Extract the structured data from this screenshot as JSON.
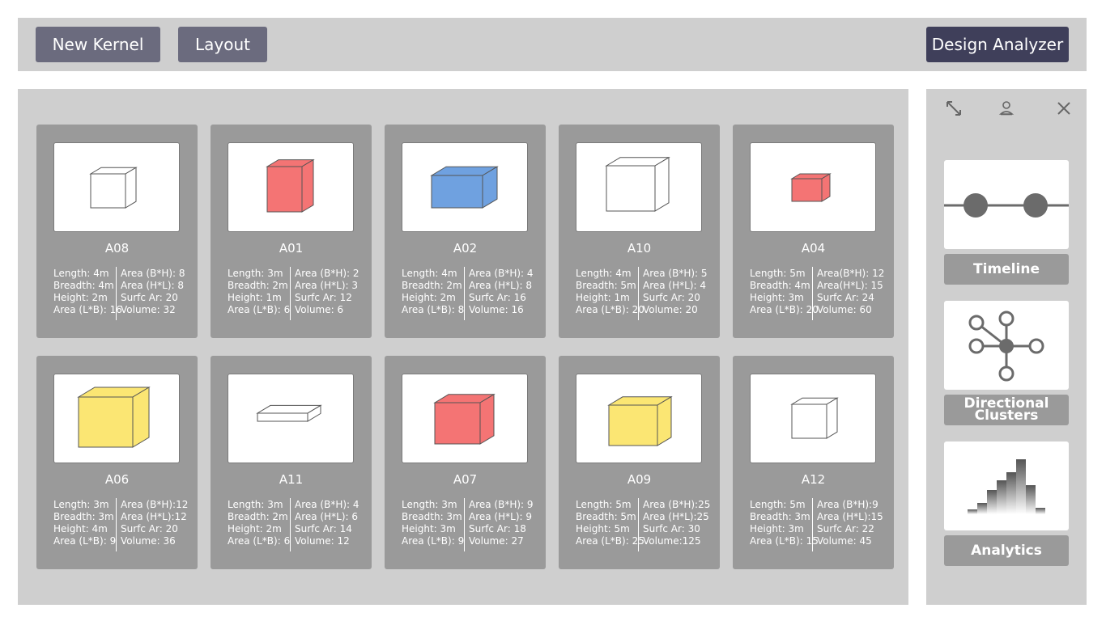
{
  "toolbar": {
    "new_kernel_label": "New Kernel",
    "layout_label": "Layout",
    "design_analyzer_label": "Design Analyzer"
  },
  "side": {
    "icons": [
      "resize-icon",
      "user-icon",
      "close-icon"
    ],
    "timeline_label": "Timeline",
    "clusters_label_line1": "Directional",
    "clusters_label_line2": "Clusters",
    "analytics_label": "Analytics"
  },
  "cards": [
    {
      "name": "A08",
      "color": "#ffffff",
      "left": [
        "Length: 4m",
        "Breadth: 4m",
        "Height: 2m",
        "Area (L*B): 16"
      ],
      "right": [
        "Area (B*H): 8",
        "Area (H*L): 8",
        "Surfc Ar: 20",
        "Volume: 32"
      ]
    },
    {
      "name": "A01",
      "color": "#f47474",
      "left": [
        "Length: 3m",
        "Breadth: 2m",
        "Height: 1m",
        "Area (L*B): 6"
      ],
      "right": [
        "Area (B*H): 2",
        "Area (H*L): 3",
        "Surfc Ar: 12",
        "Volume: 6"
      ]
    },
    {
      "name": "A02",
      "color": "#6fa1e0",
      "left": [
        "Length: 4m",
        "Breadth: 2m",
        "Height: 2m",
        "Area (L*B): 8"
      ],
      "right": [
        "Area (B*H): 4",
        "Area (H*L): 8",
        "Surfc Ar: 16",
        "Volume: 16"
      ]
    },
    {
      "name": "A10",
      "color": "#ffffff",
      "left": [
        "Length: 4m",
        "Breadth: 5m",
        "Height: 1m",
        "Area (L*B): 20"
      ],
      "right": [
        "Area (B*H): 5",
        "Area (H*L): 4",
        "Surfc Ar: 20",
        "Volume: 20"
      ]
    },
    {
      "name": "A04",
      "color": "#f47474",
      "left": [
        "Length: 5m",
        "Breadth: 4m",
        "Height: 3m",
        "Area (L*B): 20"
      ],
      "right": [
        "Area(B*H): 12",
        "Area(H*L): 15",
        "Surfc Ar: 24",
        "Volume: 60"
      ]
    },
    {
      "name": "A06",
      "color": "#fbe673",
      "left": [
        "Length: 3m",
        "Breadth: 3m",
        "Height: 4m",
        "Area (L*B): 9"
      ],
      "right": [
        "Area (B*H):12",
        "Area (H*L):12",
        "Surfc Ar: 20",
        "Volume: 36"
      ]
    },
    {
      "name": "A11",
      "color": "#ffffff",
      "left": [
        "Length: 3m",
        "Breadth: 2m",
        "Height: 2m",
        "Area (L*B): 6"
      ],
      "right": [
        "Area (B*H): 4",
        "Area (H*L): 6",
        "Surfc Ar: 14",
        "Volume: 12"
      ]
    },
    {
      "name": "A07",
      "color": "#f47474",
      "left": [
        "Length: 3m",
        "Breadth: 3m",
        "Height: 3m",
        "Area (L*B): 9"
      ],
      "right": [
        "Area (B*H): 9",
        "Area (H*L): 9",
        "Surfc Ar: 18",
        "Volume: 27"
      ]
    },
    {
      "name": "A09",
      "color": "#fbe673",
      "left": [
        "Length: 5m",
        "Breadth: 5m",
        "Height: 5m",
        "Area (L*B): 25"
      ],
      "right": [
        "Area (B*H):25",
        "Area (H*L):25",
        "Surfc Ar: 30",
        "Volume:125"
      ]
    },
    {
      "name": "A12",
      "color": "#ffffff",
      "left": [
        "Length: 5m",
        "Breadth: 3m",
        "Height: 3m",
        "Area (L*B): 15"
      ],
      "right": [
        "Area (B*H):9",
        "Area (H*L):15",
        "Surfc Ar: 22",
        "Volume: 45"
      ]
    }
  ]
}
